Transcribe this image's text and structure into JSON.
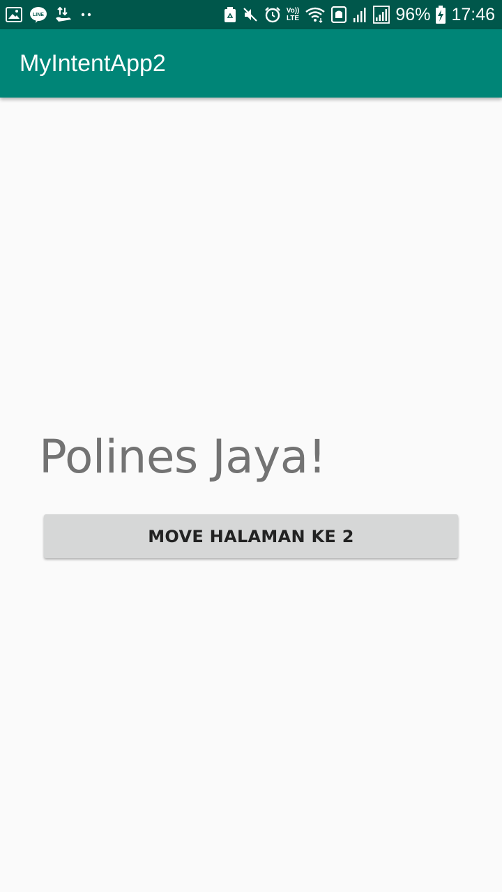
{
  "status_bar": {
    "left_icons": [
      "gallery-icon",
      "line-app-icon",
      "data-transfer-icon",
      "more-dots-icon"
    ],
    "line_label": "LINE",
    "volte_label_top": "Vo))",
    "volte_label_bottom": "LTE",
    "battery_percent": "96%",
    "time": "17:46",
    "background_color": "#00574b"
  },
  "app_bar": {
    "title": "MyIntentApp2",
    "background_color": "#008577"
  },
  "main": {
    "greeting": "Polines Jaya!",
    "move_button_label": "MOVE HALAMAN KE 2"
  }
}
